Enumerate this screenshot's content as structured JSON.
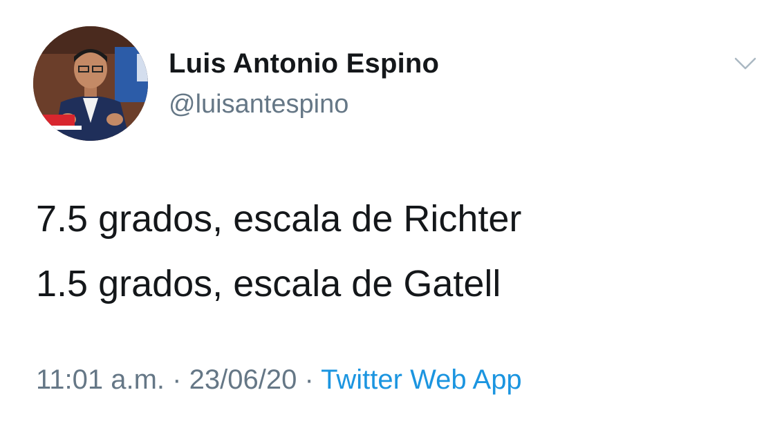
{
  "author": {
    "display_name": "Luis Antonio Espino",
    "handle": "@luisantespino",
    "avatar_icon": "profile-photo"
  },
  "tweet": {
    "lines": [
      "7.5 grados, escala de Richter",
      "1.5 grados, escala de Gatell"
    ]
  },
  "meta": {
    "time": "11:01 a.m.",
    "separator": "·",
    "date": "23/06/20",
    "source": "Twitter Web App"
  },
  "icons": {
    "menu": "chevron-down-icon"
  },
  "colors": {
    "text": "#14171a",
    "secondary": "#657786",
    "link": "#1b95e0",
    "background": "#ffffff"
  }
}
